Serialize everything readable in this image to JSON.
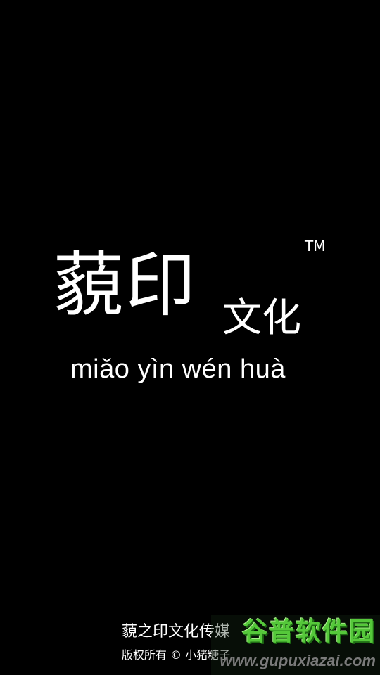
{
  "splash": {
    "logo_main": "藐印",
    "logo_sub": "文化",
    "trademark": "TM",
    "pinyin": "miǎo yìn wén huà"
  },
  "footer": {
    "company": "藐之印文化传媒",
    "copyright": "版权所有 © 小猪糖子"
  },
  "watermark": {
    "title": "谷普软件园",
    "url": "www.gupuxiazai.com"
  },
  "colors": {
    "background": "#000000",
    "text": "#ffffff",
    "watermark_green": "#55c83a"
  }
}
